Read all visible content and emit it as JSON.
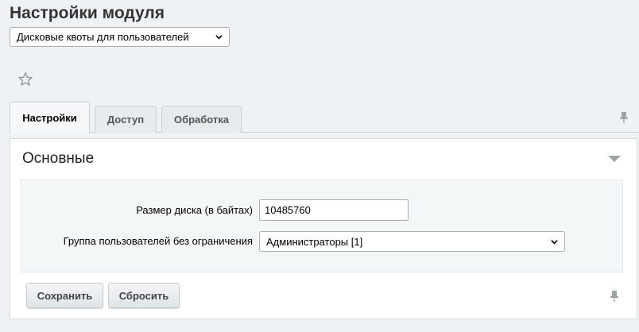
{
  "page": {
    "title": "Настройки модуля"
  },
  "module_select": {
    "value": "Дисковые квоты для пользователей"
  },
  "tabs": [
    {
      "label": "Настройки",
      "active": true
    },
    {
      "label": "Доступ",
      "active": false
    },
    {
      "label": "Обработка",
      "active": false
    }
  ],
  "section": {
    "title": "Основные"
  },
  "form": {
    "disk_size_label": "Размер диска (в байтах)",
    "disk_size_value": "10485760",
    "group_label": "Группа пользователей без ограничения",
    "group_value": "Администраторы [1]"
  },
  "buttons": {
    "save": "Сохранить",
    "reset": "Сбросить"
  },
  "icons": {
    "favorite": "star-icon",
    "pin": "pin-icon",
    "collapse": "triangle-down-icon",
    "dropdown": "chevron-down-icon"
  }
}
